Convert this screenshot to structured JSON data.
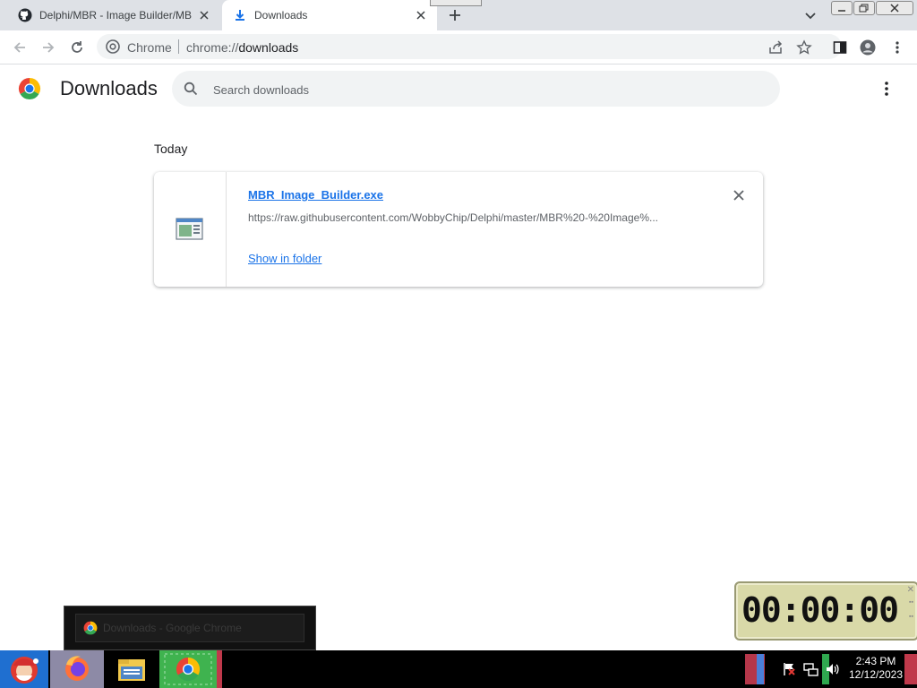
{
  "browser": {
    "tabs": [
      {
        "title": "Delphi/MBR - Image Builder/MBR",
        "icon": "github-icon",
        "active": false
      },
      {
        "title": "Downloads",
        "icon": "download-icon",
        "active": true
      }
    ],
    "omnibox": {
      "chip": "Chrome",
      "url_scheme": "chrome://",
      "url_host": "downloads"
    }
  },
  "downloads_page": {
    "title": "Downloads",
    "search_placeholder": "Search downloads",
    "section_label": "Today",
    "items": [
      {
        "filename": "MBR_Image_Builder.exe",
        "url": "https://raw.githubusercontent.com/WobbyChip/Delphi/master/MBR%20-%20Image%...",
        "action_label": "Show in folder"
      }
    ]
  },
  "taskbar": {
    "thumbnail_title": "Downloads - Google Chrome",
    "clock_time": "2:43 PM",
    "clock_date": "12/12/2023"
  },
  "timer_widget": {
    "display": "00:00:00"
  },
  "colors": {
    "accent": "#1a73e8",
    "tabstrip": "#dee1e6",
    "omnibox": "#f1f3f4"
  }
}
